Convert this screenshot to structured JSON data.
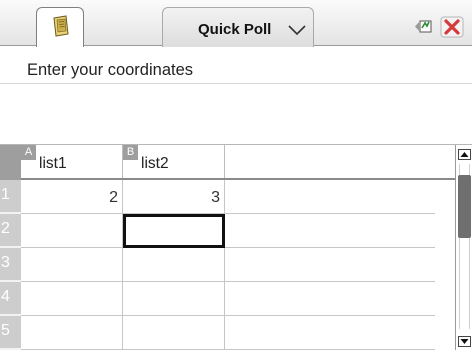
{
  "titlebar": {
    "active_tab": "Quick Poll",
    "doc_icon": "document-icon",
    "status_icon": "connectivity-icon",
    "close_icon": "close-icon",
    "close_color": "#d63a3a"
  },
  "question": {
    "prompt": "Enter your coordinates"
  },
  "sheet": {
    "columns": [
      {
        "letter": "A",
        "name": "list1"
      },
      {
        "letter": "B",
        "name": "list2"
      }
    ],
    "rows": [
      {
        "num": "1",
        "cells": [
          "2",
          "3"
        ]
      },
      {
        "num": "2",
        "cells": [
          "",
          ""
        ]
      },
      {
        "num": "3",
        "cells": [
          "",
          ""
        ]
      },
      {
        "num": "4",
        "cells": [
          "",
          ""
        ]
      },
      {
        "num": "5",
        "cells": [
          "",
          ""
        ]
      }
    ],
    "selected_cell": "B2"
  }
}
